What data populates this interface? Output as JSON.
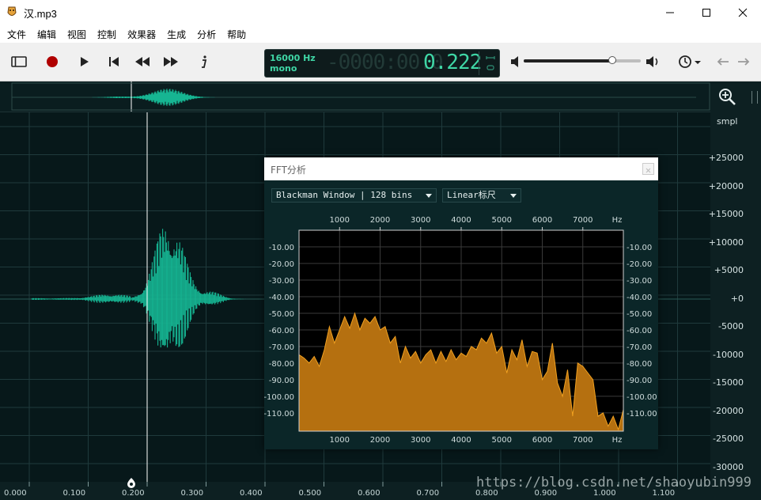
{
  "window": {
    "title": "汉.mp3",
    "minimize_icon": "minimize-icon",
    "maximize_icon": "maximize-icon",
    "close_icon": "close-icon"
  },
  "menu": [
    "文件",
    "编辑",
    "视图",
    "控制",
    "效果器",
    "生成",
    "分析",
    "帮助"
  ],
  "toolbar": {
    "icons": [
      "sidebar-toggle-icon",
      "record-icon",
      "play-icon",
      "skip-to-start-icon",
      "rewind-icon",
      "fast-forward-icon",
      "info-icon"
    ],
    "sample_rate": "16000 Hz",
    "channels": "mono",
    "time_dim": "-0000:00:0",
    "time_value": "0.222",
    "volume_level": 0.76,
    "right_icons": [
      "volume-down-icon",
      "volume-up-icon",
      "clock-icon",
      "back-arrow-icon",
      "forward-arrow-icon"
    ],
    "accent": "#3fd7a6",
    "record_color": "#b00000"
  },
  "editor": {
    "unit_label": "smpl",
    "y_ticks": [
      "+25000",
      "+20000",
      "+15000",
      "+10000",
      "+5000",
      "+0",
      "-5000",
      "-10000",
      "-15000",
      "-20000",
      "-25000",
      "-30000"
    ],
    "x_ticks": [
      "0.000",
      "0.100",
      "0.200",
      "0.300",
      "0.400",
      "0.500",
      "0.600",
      "0.700",
      "0.800",
      "0.900",
      "1.000",
      "1.100"
    ],
    "cursor_time": 0.2,
    "waveform_color": "#16b592",
    "watermark": "https://blog.csdn.net/shaoyubin999"
  },
  "fft": {
    "title": "FFT分析",
    "window_select": "Blackman Window | 128 bins",
    "scale_select": "Linear标尺",
    "fill_color": "#b57010",
    "line_color": "#f0a020"
  },
  "chart_data": {
    "type": "area",
    "title": "FFT分析",
    "xlabel": "Hz",
    "ylabel": "",
    "x_ticks": [
      1000,
      2000,
      3000,
      4000,
      5000,
      6000,
      7000
    ],
    "x_tick_labels": [
      "1000",
      "2000",
      "3000",
      "4000",
      "5000",
      "6000",
      "7000"
    ],
    "y_ticks": [
      -10,
      -20,
      -30,
      -40,
      -50,
      -60,
      -70,
      -80,
      -90,
      -100,
      -110
    ],
    "y_tick_labels": [
      "-10.00",
      "-20.00",
      "-30.00",
      "-40.00",
      "-50.00",
      "-60.00",
      "-70.00",
      "-80.00",
      "-90.00",
      "-100.00",
      "-110.00"
    ],
    "xlim": [
      0,
      8000
    ],
    "ylim": [
      -121,
      0
    ],
    "grid": true,
    "x": [
      0,
      125,
      250,
      375,
      500,
      625,
      750,
      875,
      1000,
      1125,
      1250,
      1375,
      1500,
      1625,
      1750,
      1875,
      2000,
      2125,
      2250,
      2375,
      2500,
      2625,
      2750,
      2875,
      3000,
      3125,
      3250,
      3375,
      3500,
      3625,
      3750,
      3875,
      4000,
      4125,
      4250,
      4375,
      4500,
      4625,
      4750,
      4875,
      5000,
      5125,
      5250,
      5375,
      5500,
      5625,
      5750,
      5875,
      6000,
      6125,
      6250,
      6375,
      6500,
      6625,
      6750,
      6875,
      7000,
      7125,
      7250,
      7375,
      7500,
      7625,
      7750,
      7875,
      8000
    ],
    "values": [
      -75,
      -77,
      -80,
      -76,
      -82,
      -72,
      -58,
      -68,
      -60,
      -52,
      -59,
      -50,
      -60,
      -53,
      -56,
      -52,
      -60,
      -58,
      -68,
      -64,
      -80,
      -70,
      -77,
      -73,
      -80,
      -75,
      -72,
      -80,
      -73,
      -79,
      -72,
      -78,
      -74,
      -76,
      -70,
      -72,
      -65,
      -68,
      -62,
      -74,
      -70,
      -86,
      -72,
      -78,
      -66,
      -82,
      -73,
      -74,
      -90,
      -85,
      -68,
      -92,
      -100,
      -84,
      -112,
      -80,
      -82,
      -86,
      -90,
      -112,
      -110,
      -118,
      -112,
      -120,
      -108
    ]
  }
}
